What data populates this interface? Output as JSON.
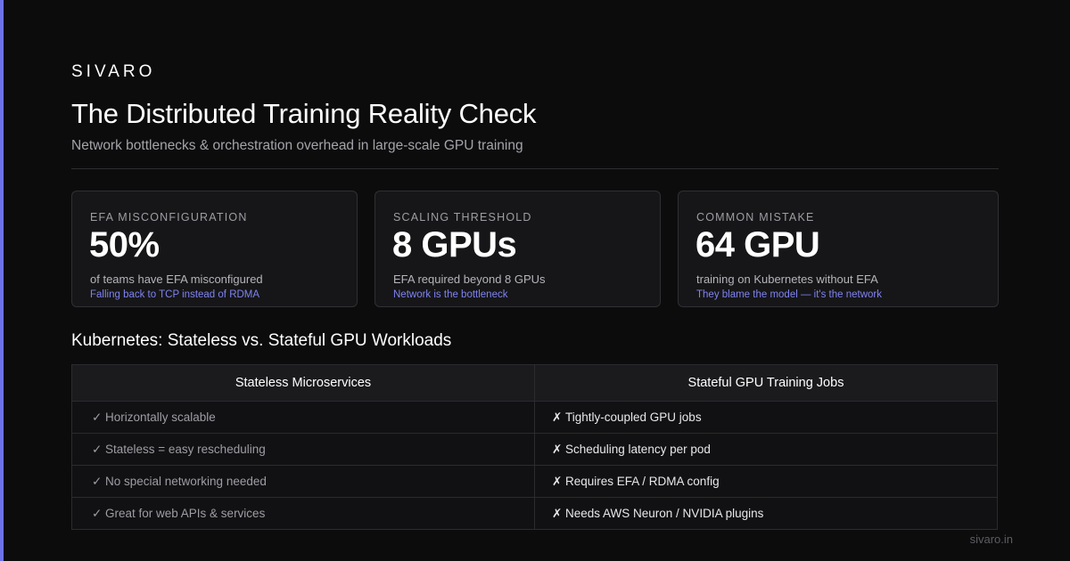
{
  "brand": "SIVARO",
  "title": "The Distributed Training Reality Check",
  "subtitle": "Network bottlenecks & orchestration overhead in large-scale GPU training",
  "cards": [
    {
      "label": "EFA MISCONFIGURATION",
      "value": "50%",
      "desc": "of teams have EFA misconfigured",
      "note": "Falling back to TCP instead of RDMA"
    },
    {
      "label": "SCALING THRESHOLD",
      "value": "8 GPUs",
      "desc": "EFA required beyond 8 GPUs",
      "note": "Network is the bottleneck"
    },
    {
      "label": "COMMON MISTAKE",
      "value": "64 GPU",
      "desc": "training on Kubernetes without EFA",
      "note": "They blame the model — it's the network"
    }
  ],
  "section_title": "Kubernetes: Stateless vs. Stateful GPU Workloads",
  "table": {
    "headers": [
      "Stateless Microservices",
      "Stateful GPU Training Jobs"
    ],
    "check_mark": "✓",
    "cross_mark": "✗",
    "rows": [
      {
        "left": "Horizontally scalable",
        "right": "Tightly-coupled GPU jobs"
      },
      {
        "left": "Stateless = easy rescheduling",
        "right": "Scheduling latency per pod"
      },
      {
        "left": "No special networking needed",
        "right": "Requires EFA / RDMA config"
      },
      {
        "left": "Great for web APIs & services",
        "right": "Needs AWS Neuron / NVIDIA plugins"
      }
    ]
  },
  "footer": "sivaro.in",
  "colors": {
    "accent": "#6d72e8",
    "note": "#7f83f0",
    "background": "#0c0c0d"
  }
}
